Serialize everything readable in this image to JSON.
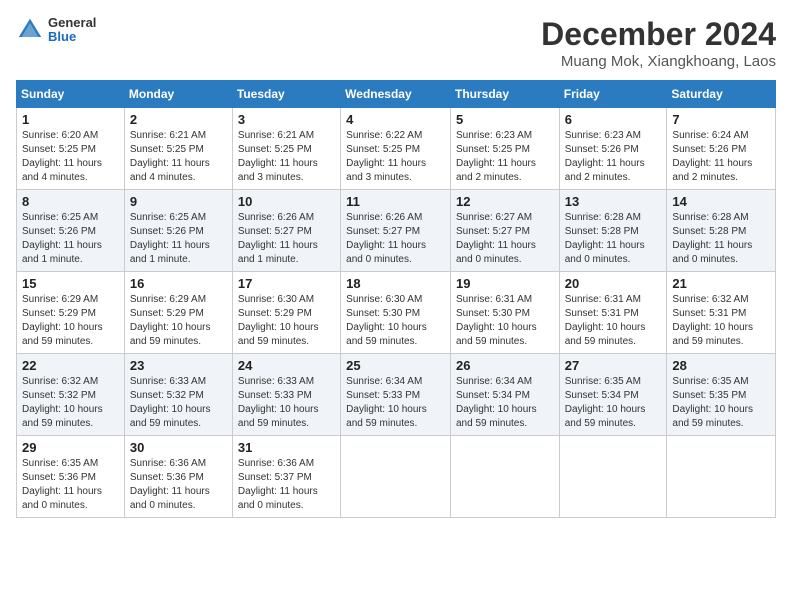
{
  "logo": {
    "general": "General",
    "blue": "Blue"
  },
  "title": "December 2024",
  "location": "Muang Mok, Xiangkhoang, Laos",
  "weekdays": [
    "Sunday",
    "Monday",
    "Tuesday",
    "Wednesday",
    "Thursday",
    "Friday",
    "Saturday"
  ],
  "weeks": [
    [
      {
        "day": "1",
        "info": "Sunrise: 6:20 AM\nSunset: 5:25 PM\nDaylight: 11 hours\nand 4 minutes."
      },
      {
        "day": "2",
        "info": "Sunrise: 6:21 AM\nSunset: 5:25 PM\nDaylight: 11 hours\nand 4 minutes."
      },
      {
        "day": "3",
        "info": "Sunrise: 6:21 AM\nSunset: 5:25 PM\nDaylight: 11 hours\nand 3 minutes."
      },
      {
        "day": "4",
        "info": "Sunrise: 6:22 AM\nSunset: 5:25 PM\nDaylight: 11 hours\nand 3 minutes."
      },
      {
        "day": "5",
        "info": "Sunrise: 6:23 AM\nSunset: 5:25 PM\nDaylight: 11 hours\nand 2 minutes."
      },
      {
        "day": "6",
        "info": "Sunrise: 6:23 AM\nSunset: 5:26 PM\nDaylight: 11 hours\nand 2 minutes."
      },
      {
        "day": "7",
        "info": "Sunrise: 6:24 AM\nSunset: 5:26 PM\nDaylight: 11 hours\nand 2 minutes."
      }
    ],
    [
      {
        "day": "8",
        "info": "Sunrise: 6:25 AM\nSunset: 5:26 PM\nDaylight: 11 hours\nand 1 minute."
      },
      {
        "day": "9",
        "info": "Sunrise: 6:25 AM\nSunset: 5:26 PM\nDaylight: 11 hours\nand 1 minute."
      },
      {
        "day": "10",
        "info": "Sunrise: 6:26 AM\nSunset: 5:27 PM\nDaylight: 11 hours\nand 1 minute."
      },
      {
        "day": "11",
        "info": "Sunrise: 6:26 AM\nSunset: 5:27 PM\nDaylight: 11 hours\nand 0 minutes."
      },
      {
        "day": "12",
        "info": "Sunrise: 6:27 AM\nSunset: 5:27 PM\nDaylight: 11 hours\nand 0 minutes."
      },
      {
        "day": "13",
        "info": "Sunrise: 6:28 AM\nSunset: 5:28 PM\nDaylight: 11 hours\nand 0 minutes."
      },
      {
        "day": "14",
        "info": "Sunrise: 6:28 AM\nSunset: 5:28 PM\nDaylight: 11 hours\nand 0 minutes."
      }
    ],
    [
      {
        "day": "15",
        "info": "Sunrise: 6:29 AM\nSunset: 5:29 PM\nDaylight: 10 hours\nand 59 minutes."
      },
      {
        "day": "16",
        "info": "Sunrise: 6:29 AM\nSunset: 5:29 PM\nDaylight: 10 hours\nand 59 minutes."
      },
      {
        "day": "17",
        "info": "Sunrise: 6:30 AM\nSunset: 5:29 PM\nDaylight: 10 hours\nand 59 minutes."
      },
      {
        "day": "18",
        "info": "Sunrise: 6:30 AM\nSunset: 5:30 PM\nDaylight: 10 hours\nand 59 minutes."
      },
      {
        "day": "19",
        "info": "Sunrise: 6:31 AM\nSunset: 5:30 PM\nDaylight: 10 hours\nand 59 minutes."
      },
      {
        "day": "20",
        "info": "Sunrise: 6:31 AM\nSunset: 5:31 PM\nDaylight: 10 hours\nand 59 minutes."
      },
      {
        "day": "21",
        "info": "Sunrise: 6:32 AM\nSunset: 5:31 PM\nDaylight: 10 hours\nand 59 minutes."
      }
    ],
    [
      {
        "day": "22",
        "info": "Sunrise: 6:32 AM\nSunset: 5:32 PM\nDaylight: 10 hours\nand 59 minutes."
      },
      {
        "day": "23",
        "info": "Sunrise: 6:33 AM\nSunset: 5:32 PM\nDaylight: 10 hours\nand 59 minutes."
      },
      {
        "day": "24",
        "info": "Sunrise: 6:33 AM\nSunset: 5:33 PM\nDaylight: 10 hours\nand 59 minutes."
      },
      {
        "day": "25",
        "info": "Sunrise: 6:34 AM\nSunset: 5:33 PM\nDaylight: 10 hours\nand 59 minutes."
      },
      {
        "day": "26",
        "info": "Sunrise: 6:34 AM\nSunset: 5:34 PM\nDaylight: 10 hours\nand 59 minutes."
      },
      {
        "day": "27",
        "info": "Sunrise: 6:35 AM\nSunset: 5:34 PM\nDaylight: 10 hours\nand 59 minutes."
      },
      {
        "day": "28",
        "info": "Sunrise: 6:35 AM\nSunset: 5:35 PM\nDaylight: 10 hours\nand 59 minutes."
      }
    ],
    [
      {
        "day": "29",
        "info": "Sunrise: 6:35 AM\nSunset: 5:36 PM\nDaylight: 11 hours\nand 0 minutes."
      },
      {
        "day": "30",
        "info": "Sunrise: 6:36 AM\nSunset: 5:36 PM\nDaylight: 11 hours\nand 0 minutes."
      },
      {
        "day": "31",
        "info": "Sunrise: 6:36 AM\nSunset: 5:37 PM\nDaylight: 11 hours\nand 0 minutes."
      },
      {
        "day": "",
        "info": ""
      },
      {
        "day": "",
        "info": ""
      },
      {
        "day": "",
        "info": ""
      },
      {
        "day": "",
        "info": ""
      }
    ]
  ]
}
